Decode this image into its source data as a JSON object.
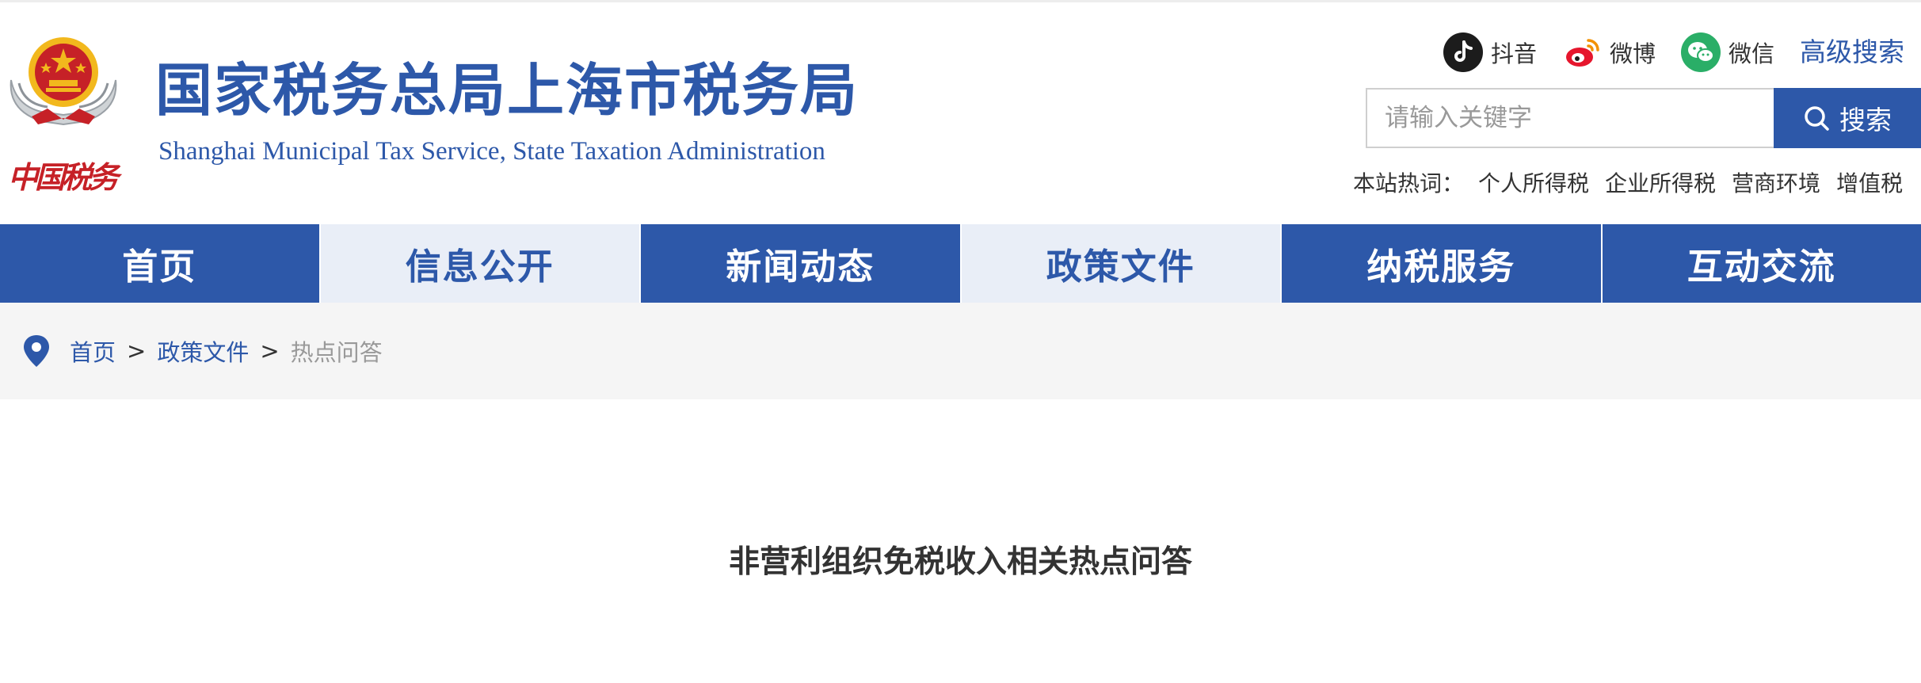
{
  "header": {
    "title_cn": "国家税务总局上海市税务局",
    "title_en": "Shanghai Municipal Tax Service, State Taxation Administration",
    "logo_text": "中国税务",
    "social": [
      {
        "label": "抖音",
        "icon": "douyin-icon"
      },
      {
        "label": "微博",
        "icon": "weibo-icon"
      },
      {
        "label": "微信",
        "icon": "wechat-icon"
      }
    ],
    "advanced_search": "高级搜索",
    "search": {
      "placeholder": "请输入关键字",
      "button_label": "搜索"
    },
    "hot_words": {
      "label": "本站热词：",
      "items": [
        "个人所得税",
        "企业所得税",
        "营商环境",
        "增值税"
      ]
    }
  },
  "nav": {
    "items": [
      {
        "label": "首页",
        "style": "dark"
      },
      {
        "label": "信息公开",
        "style": "light"
      },
      {
        "label": "新闻动态",
        "style": "dark"
      },
      {
        "label": "政策文件",
        "style": "light"
      },
      {
        "label": "纳税服务",
        "style": "dark"
      },
      {
        "label": "互动交流",
        "style": "dark"
      }
    ]
  },
  "breadcrumb": {
    "items": [
      "首页",
      "政策文件"
    ],
    "separator": ">",
    "current": "热点问答"
  },
  "article": {
    "title": "非营利组织免税收入相关热点问答"
  },
  "colors": {
    "brand_blue": "#2d58a9",
    "nav_light": "#e9eef7",
    "emblem_red": "#c62127",
    "emblem_gold": "#f2b81d",
    "douyin": "#1c1c1c",
    "weibo": "#e6162d",
    "wechat": "#2aae67"
  }
}
